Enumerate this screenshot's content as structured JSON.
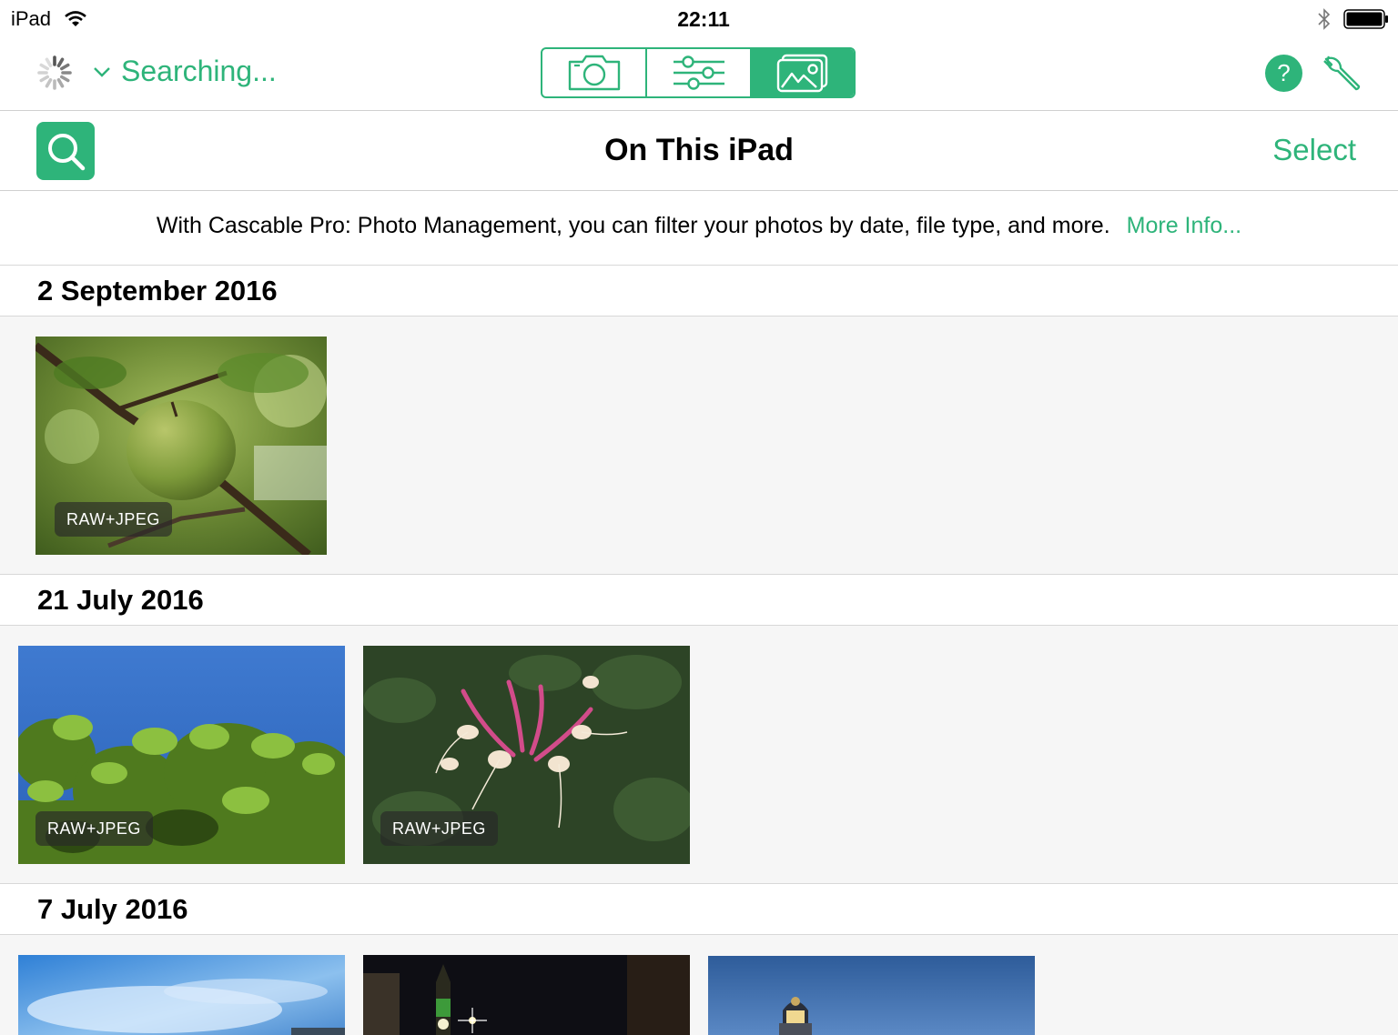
{
  "status_bar": {
    "device": "iPad",
    "time": "22:11"
  },
  "toolbar": {
    "searching_label": "Searching...",
    "segments": [
      "camera",
      "settings",
      "photos"
    ],
    "help_label": "?"
  },
  "navbar": {
    "title": "On This iPad",
    "select_label": "Select"
  },
  "promo": {
    "text": "With Cascable Pro: Photo Management, you can filter your photos by date, file type, and more.",
    "link": "More Info..."
  },
  "sections": [
    {
      "date": "2 September 2016",
      "photos": [
        {
          "badge": "RAW+JPEG",
          "subject": "apple"
        }
      ]
    },
    {
      "date": "21 July 2016",
      "photos": [
        {
          "badge": "RAW+JPEG",
          "subject": "leaves"
        },
        {
          "badge": "RAW+JPEG",
          "subject": "honeysuckle"
        }
      ]
    },
    {
      "date": "7 July 2016",
      "photos": [
        {
          "subject": "sky"
        },
        {
          "subject": "night-clock-tower"
        },
        {
          "subject": "lighthouse"
        }
      ]
    }
  ],
  "colors": {
    "accent": "#2eb47a",
    "background": "#f6f6f6"
  }
}
